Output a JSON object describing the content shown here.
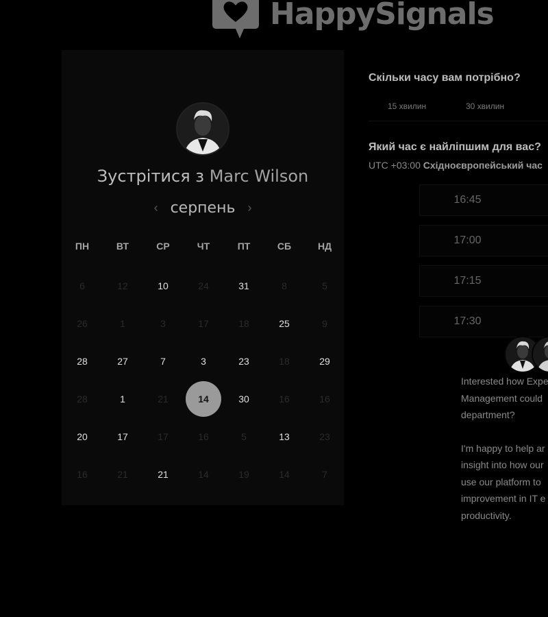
{
  "logo": {
    "text": "HappySignals"
  },
  "calendar": {
    "host_prefix": "Зустрітися з",
    "host_name": "Marc Wilson",
    "month": "серпень",
    "prev_icon": "chevron-left-icon",
    "next_icon": "chevron-right-icon",
    "weekdays": [
      "ПН",
      "ВТ",
      "СР",
      "ЧТ",
      "ПТ",
      "СБ",
      "НД"
    ],
    "weeks": [
      [
        {
          "d": "6",
          "a": false
        },
        {
          "d": "12",
          "a": false
        },
        {
          "d": "10",
          "a": true
        },
        {
          "d": "24",
          "a": false
        },
        {
          "d": "31",
          "a": true
        },
        {
          "d": "8",
          "a": false
        },
        {
          "d": "5",
          "a": false
        }
      ],
      [
        {
          "d": "26",
          "a": false
        },
        {
          "d": "1",
          "a": false
        },
        {
          "d": "3",
          "a": false
        },
        {
          "d": "17",
          "a": false
        },
        {
          "d": "18",
          "a": false
        },
        {
          "d": "25",
          "a": true
        },
        {
          "d": "9",
          "a": false
        }
      ],
      [
        {
          "d": "28",
          "a": true
        },
        {
          "d": "27",
          "a": true
        },
        {
          "d": "7",
          "a": true
        },
        {
          "d": "3",
          "a": true
        },
        {
          "d": "23",
          "a": true
        },
        {
          "d": "18",
          "a": false
        },
        {
          "d": "29",
          "a": true
        }
      ],
      [
        {
          "d": "28",
          "a": false
        },
        {
          "d": "1",
          "a": true
        },
        {
          "d": "21",
          "a": false
        },
        {
          "d": "14",
          "a": true,
          "sel": true
        },
        {
          "d": "30",
          "a": true
        },
        {
          "d": "16",
          "a": false
        },
        {
          "d": "16",
          "a": false
        }
      ],
      [
        {
          "d": "20",
          "a": true
        },
        {
          "d": "17",
          "a": true
        },
        {
          "d": "17",
          "a": false
        },
        {
          "d": "16",
          "a": false
        },
        {
          "d": "5",
          "a": false
        },
        {
          "d": "13",
          "a": true
        },
        {
          "d": "23",
          "a": false
        }
      ],
      [
        {
          "d": "16",
          "a": false
        },
        {
          "d": "21",
          "a": false
        },
        {
          "d": "21",
          "a": true
        },
        {
          "d": "14",
          "a": false
        },
        {
          "d": "19",
          "a": false
        },
        {
          "d": "14",
          "a": false
        },
        {
          "d": "7",
          "a": false
        }
      ]
    ]
  },
  "duration": {
    "question": "Скільки часу вам потрібно?",
    "options": [
      "15 хвилин",
      "30 хвилин"
    ]
  },
  "time": {
    "question": "Який час є найліпшим для вас?",
    "tz_offset": "UTC +03:00",
    "tz_name": "Східноєвропейський час",
    "slots": [
      "16:45",
      "17:00",
      "17:15",
      "17:30"
    ]
  },
  "chat": {
    "paragraph1": [
      "Interested how Expe",
      "Management could",
      "department?"
    ],
    "paragraph2": [
      "I'm happy to help ar",
      "insight into how our",
      "use our platform to",
      "improvement in IT e",
      "productivity."
    ]
  }
}
